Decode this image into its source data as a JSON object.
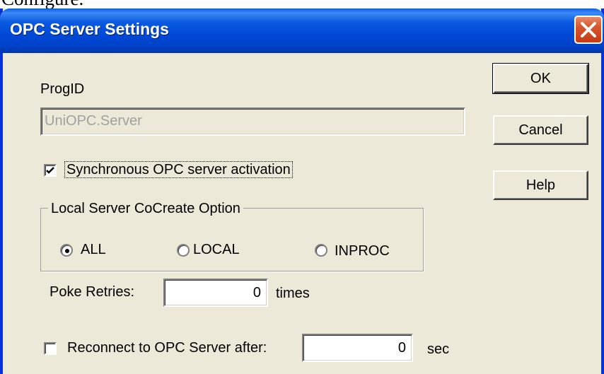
{
  "caption": "Configure.",
  "window": {
    "title": "OPC Server Settings"
  },
  "progid": {
    "label": "ProgID",
    "value": "UniOPC.Server"
  },
  "sync_activation": {
    "label": "Synchronous OPC server activation",
    "checked": true
  },
  "cocreate": {
    "title": "Local Server CoCreate Option",
    "options": [
      "ALL",
      "LOCAL",
      "INPROC"
    ],
    "selected": "ALL"
  },
  "poke_retries": {
    "label": "Poke Retries:",
    "value": "0",
    "unit": "times"
  },
  "reconnect": {
    "label": "Reconnect to OPC Server after:",
    "checked": false,
    "value": "0",
    "unit": "sec"
  },
  "buttons": {
    "ok": "OK",
    "cancel": "Cancel",
    "help": "Help"
  },
  "icons": {
    "close": "close-icon",
    "check": "checkmark-icon"
  },
  "colors": {
    "titlebar": "#0049d6",
    "dialog_bg": "#ece9d8",
    "close": "#d5562c"
  }
}
